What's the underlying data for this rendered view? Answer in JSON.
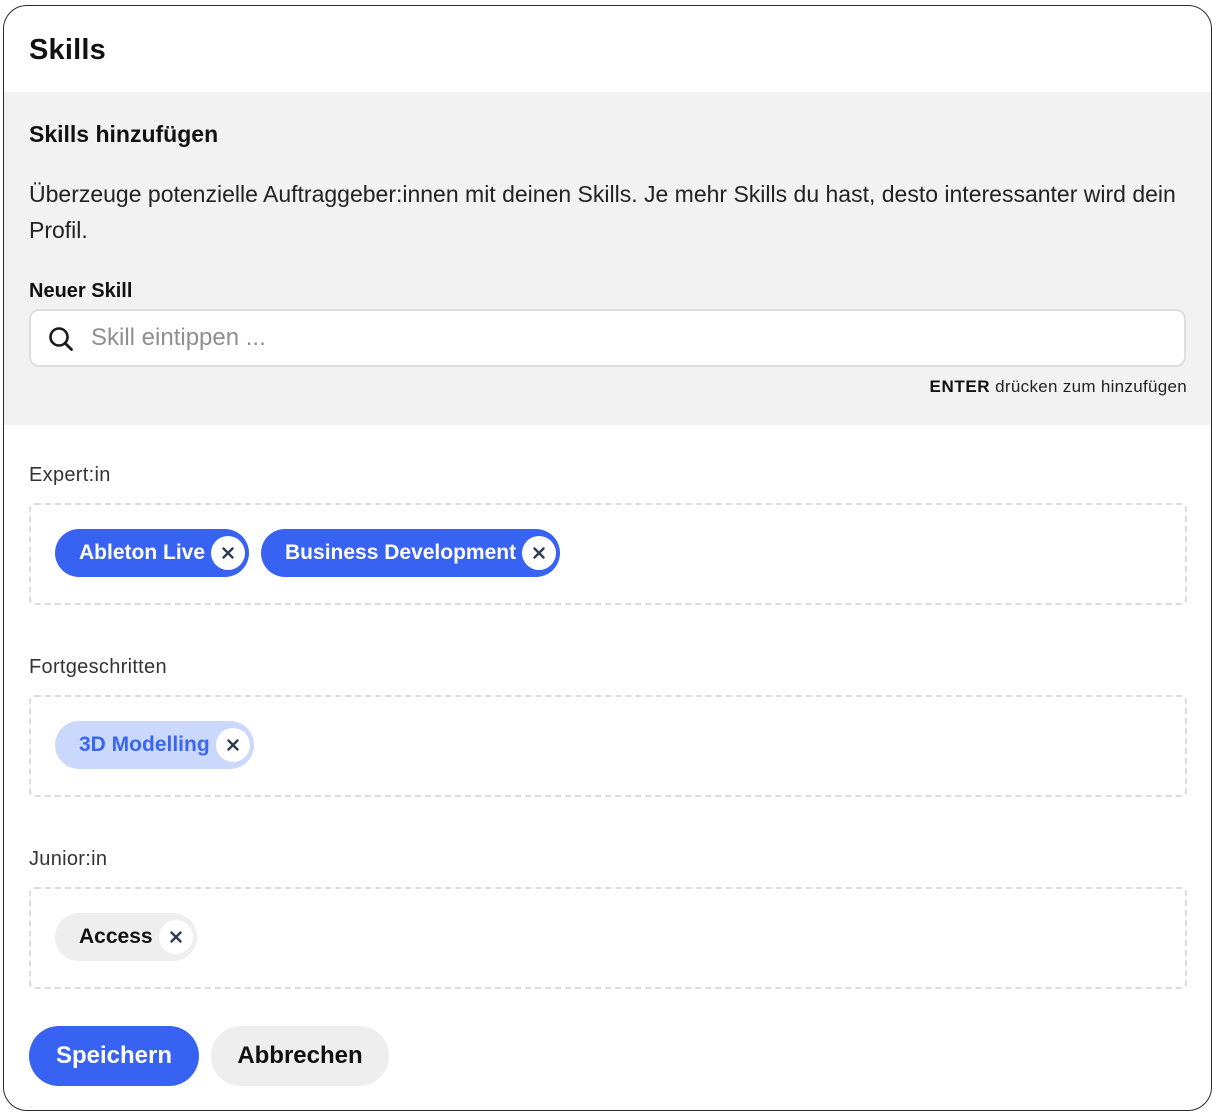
{
  "dialog": {
    "title": "Skills"
  },
  "add_skill": {
    "heading": "Skills hinzufügen",
    "description": "Überzeuge potenzielle Auftraggeber:innen mit deinen Skills. Je mehr Skills du hast, desto interessanter wird dein Profil.",
    "field_label": "Neuer Skill",
    "search_placeholder": "Skill eintippen ...",
    "search_value": "",
    "search_icon": "search-icon",
    "hint_key": "ENTER",
    "hint_text": "drücken zum hinzufügen"
  },
  "levels": {
    "expert": {
      "label": "Expert:in",
      "chip_color": "#3762f2",
      "skills": [
        "Ableton Live",
        "Business Development"
      ]
    },
    "advanced": {
      "label": "Fortgeschritten",
      "chip_color": "#cad8fb",
      "skills": [
        "3D Modelling"
      ]
    },
    "junior": {
      "label": "Junior:in",
      "chip_color": "#eeeeee",
      "skills": [
        "Access"
      ]
    }
  },
  "actions": {
    "save_label": "Speichern",
    "cancel_label": "Abbrechen",
    "accent_color": "#3762f2"
  }
}
